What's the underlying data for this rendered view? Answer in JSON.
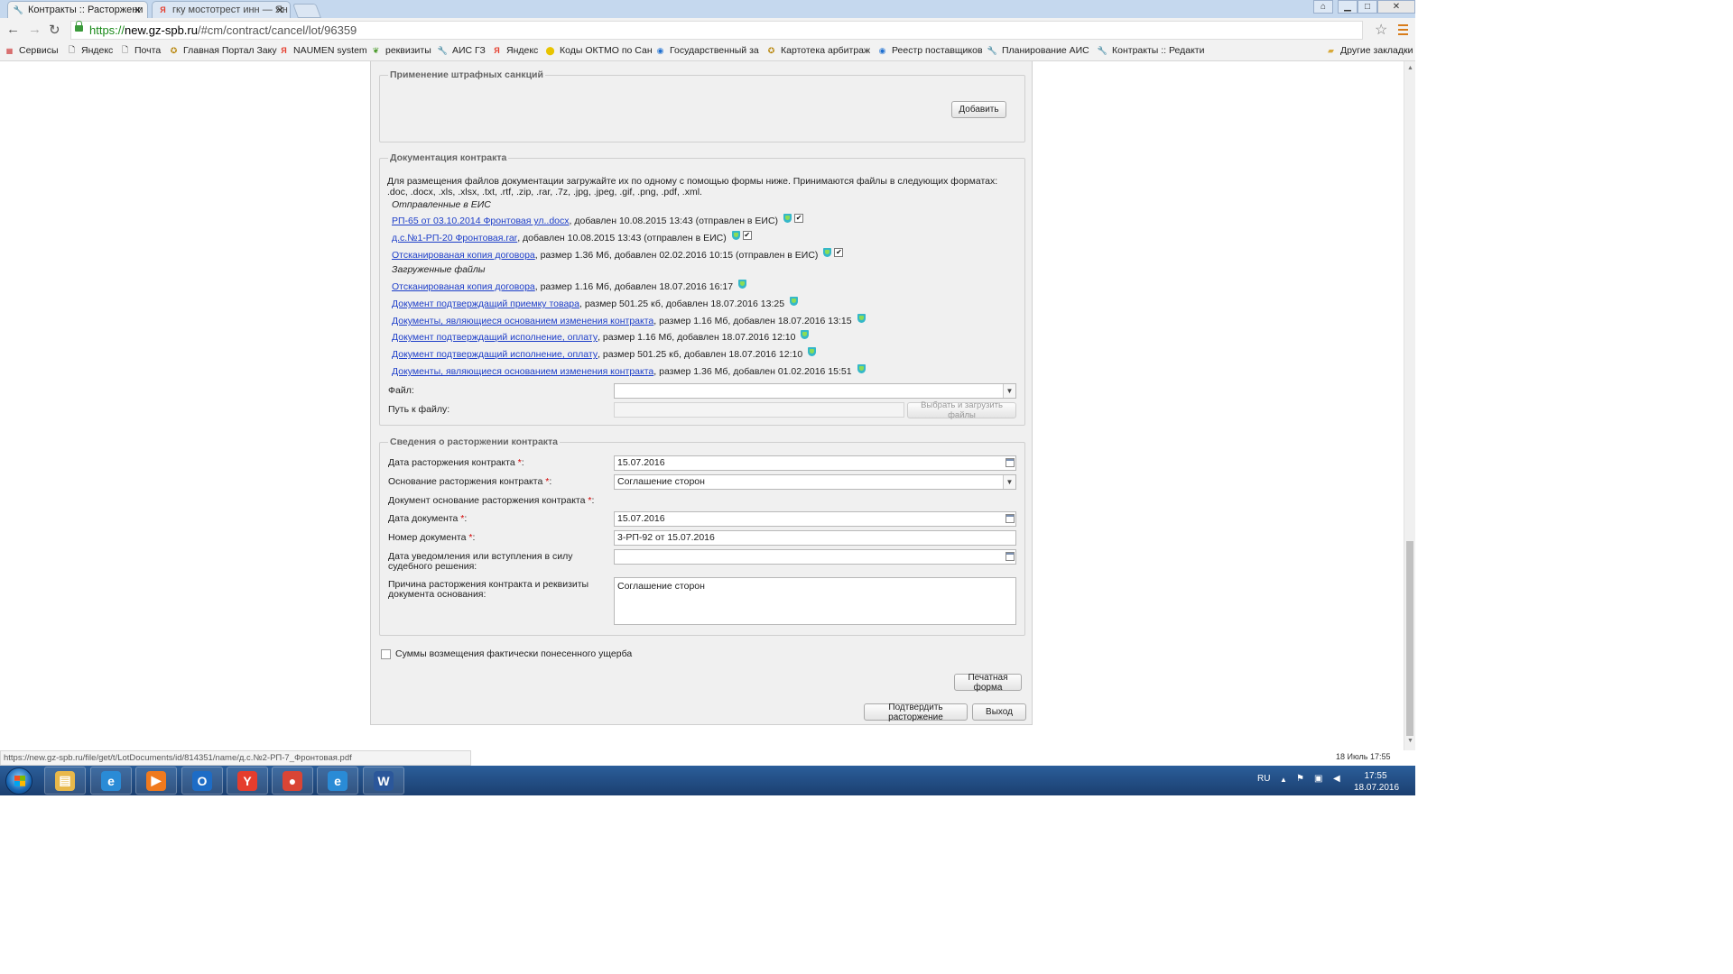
{
  "browser": {
    "tabs": [
      {
        "title": "Контракты :: Расторжени",
        "active": true,
        "close": "✕"
      },
      {
        "title": "гку мостотрест инн — Ян",
        "active": false,
        "close": "✕"
      }
    ],
    "window_buttons": {
      "minimize": "▁",
      "maximize": "□",
      "close": "✕"
    },
    "url": {
      "scheme": "https://",
      "host": "new.gz-spb.ru",
      "path": "/#cm/contract/cancel/lot/96359"
    },
    "bookmarks": [
      {
        "label": "Сервисы",
        "icon": "apps-icon"
      },
      {
        "label": "Яндекс",
        "icon": "page-icon"
      },
      {
        "label": "Почта",
        "icon": "page-icon"
      },
      {
        "label": "Главная Портал Заку",
        "icon": "emblem-icon"
      },
      {
        "label": "NAUMEN system",
        "icon": "yandex-icon"
      },
      {
        "label": "реквизиты",
        "icon": "leaf-icon"
      },
      {
        "label": "АИС ГЗ",
        "icon": "tools-icon"
      },
      {
        "label": "Яндекс",
        "icon": "yandex-icon"
      },
      {
        "label": "Коды ОКТМО по Сан",
        "icon": "circle-icon"
      },
      {
        "label": "Государственный за",
        "icon": "globe-icon"
      },
      {
        "label": "Картотека арбитраж",
        "icon": "emblem-icon"
      },
      {
        "label": "Реестр поставщиков",
        "icon": "globe-icon"
      },
      {
        "label": "Планирование АИС",
        "icon": "tools-icon"
      },
      {
        "label": "Контракты :: Редакти",
        "icon": "tools-icon"
      },
      {
        "label": "Другие закладки",
        "icon": "folder-icon"
      }
    ]
  },
  "penalties": {
    "legend": "Применение штрафных санкций",
    "add_button": "Добавить"
  },
  "docs": {
    "legend": "Документация контракта",
    "info": "Для размещения файлов документации загружайте их по одному с помощью формы ниже. Принимаются файлы в следующих форматах: .doc, .docx, .xls, .xlsx, .txt, .rtf, .zip, .rar, .7z, .jpg, .jpeg, .gif, .png, .pdf, .xml.",
    "sent_header": "Отправленные в ЕИС",
    "sent": [
      {
        "link": "РП-65 от 03.10.2014 Фронтовая ул..docx",
        "text": ", добавлен 10.08.2015 13:43 (отправлен в ЕИС)",
        "checked": "✔"
      },
      {
        "link": "д.с.№1-РП-20 Фронтовая.rar",
        "text": ", добавлен 10.08.2015 13:43 (отправлен в ЕИС)",
        "checked": "✔"
      },
      {
        "link": "Отсканированая копия договора",
        "text": ", размер 1.36 Мб, добавлен 02.02.2016 10:15 (отправлен в ЕИС)",
        "checked": "✔"
      }
    ],
    "uploaded_header": "Загруженные файлы",
    "uploaded": [
      {
        "link": "Отсканированая копия договора",
        "text": ", размер 1.16 Мб, добавлен 18.07.2016 16:17"
      },
      {
        "link": "Документ подтверждащий приемку товара",
        "text": ", размер 501.25 кб, добавлен 18.07.2016 13:25"
      },
      {
        "link": "Документы, являющиеся основанием изменения контракта",
        "text": ", размер 1.16 Мб, добавлен 18.07.2016 13:15"
      },
      {
        "link": "Документ подтверждащий исполнение, оплату",
        "text": ", размер 1.16 Мб, добавлен 18.07.2016 12:10"
      },
      {
        "link": "Документ подтверждащий исполнение, оплату",
        "text": ", размер 501.25 кб, добавлен 18.07.2016 12:10"
      },
      {
        "link": "Документы, являющиеся основанием изменения контракта",
        "text": ", размер 1.36 Мб, добавлен 01.02.2016 15:51"
      }
    ],
    "file_label": "Файл:",
    "file_value": "",
    "path_label": "Путь к файлу:",
    "path_value": "",
    "upload_button": "Выбрать и загрузить файлы"
  },
  "termination": {
    "legend": "Сведения о расторжении контракта",
    "required_mark": "*",
    "date_label": "Дата расторжения контракта ",
    "date_value": "15.07.2016",
    "basis_label": "Основание расторжения контракта ",
    "basis_value": "Соглашение сторон",
    "doc_basis_label": "Документ основание расторжения контракта ",
    "doc_date_label": "Дата документа ",
    "doc_date_value": "15.07.2016",
    "doc_number_label": "Номер документа ",
    "doc_number_value": "3-РП-92 от 15.07.2016",
    "notify_label": "Дата уведомления или вступления в силу судебного решения:",
    "notify_value": "",
    "reason_label": "Причина расторжения контракта и реквизиты документа основания:",
    "reason_value": "Соглашение сторон"
  },
  "damages_checkbox": "Суммы возмещения фактически понесенного ущерба",
  "buttons": {
    "print": "Печатная форма",
    "confirm": "Подтвердить расторжение",
    "exit": "Выход"
  },
  "status": {
    "url": "https://new.gz-spb.ru/file/get/t/LotDocuments/id/814351/name/д.с.№2-РП-7_Фронтовая.pdf",
    "date": "18 Июль 17:55"
  },
  "taskbar": {
    "apps": [
      {
        "name": "explorer",
        "icon": "folder-icon",
        "color": "#e8b84a",
        "glyph": "▤"
      },
      {
        "name": "internet-explorer",
        "icon": "ie-icon",
        "color": "#2a8bd6",
        "glyph": "e"
      },
      {
        "name": "media-player",
        "icon": "play-icon",
        "color": "#f07a1e",
        "glyph": "▶"
      },
      {
        "name": "outlook",
        "icon": "outlook-icon",
        "color": "#1d6cc6",
        "glyph": "O"
      },
      {
        "name": "yandex-browser",
        "icon": "yandex-icon",
        "color": "#e53d2d",
        "glyph": "Y"
      },
      {
        "name": "chrome",
        "icon": "chrome-icon",
        "color": "#d94535",
        "glyph": "●"
      },
      {
        "name": "internet-explorer-2",
        "icon": "ie-icon",
        "color": "#2a8bd6",
        "glyph": "e"
      },
      {
        "name": "word",
        "icon": "word-icon",
        "color": "#2b579a",
        "glyph": "W"
      }
    ],
    "lang": "RU",
    "time": "17:55",
    "date": "18.07.2016"
  }
}
